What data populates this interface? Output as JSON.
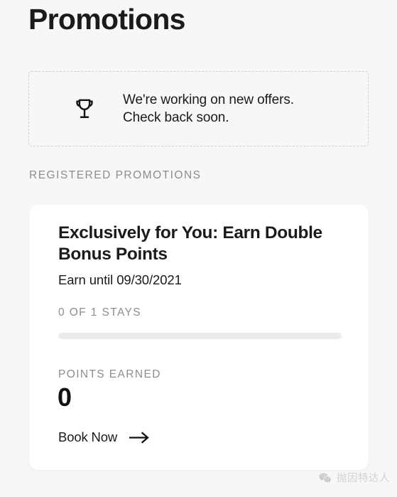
{
  "page": {
    "title": "Promotions",
    "background_color": "#f7f7f7"
  },
  "notice": {
    "icon": "trophy-icon",
    "line1": "We're working on new offers.",
    "line2": "Check back soon.",
    "border_color": "#cfcfcf"
  },
  "section": {
    "label": "REGISTERED PROMOTIONS",
    "label_color": "#8d8d8d"
  },
  "promo_card": {
    "title": "Exclusively for You: Earn Double Bonus Points",
    "subtitle": "Earn until 09/30/2021",
    "stays_label": "0 OF 1 STAYS",
    "stays_completed": 0,
    "stays_total": 1,
    "progress_percent": 0,
    "progress_track_color": "#ebebeb",
    "points_label": "POINTS EARNED",
    "points_value": "0",
    "cta_label": "Book Now",
    "cta_icon": "arrow-right-icon",
    "card_color": "#ffffff"
  },
  "watermark": {
    "logo": "wechat-logo-icon",
    "text": "抛因特达人"
  }
}
